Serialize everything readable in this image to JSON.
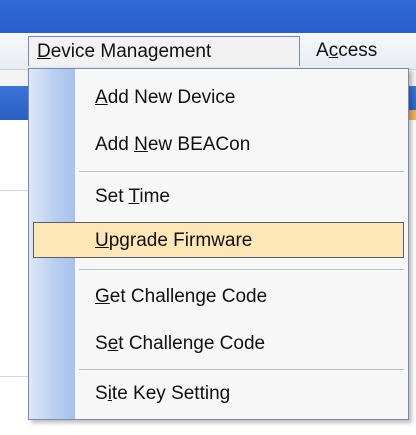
{
  "menubar": {
    "device_management": {
      "underline": "D",
      "rest": "evice Management"
    },
    "access": {
      "first": "A",
      "underline": "c",
      "rest": "cess"
    }
  },
  "menu": {
    "items": [
      {
        "pre": "",
        "underline": "A",
        "post": "dd New Device",
        "highlight": false
      },
      {
        "pre": "Add ",
        "underline": "N",
        "post": "ew BEACon",
        "highlight": false
      },
      {
        "pre": "Set ",
        "underline": "T",
        "post": "ime",
        "highlight": false
      },
      {
        "pre": "",
        "underline": "U",
        "post": "pgrade Firmware",
        "highlight": true
      },
      {
        "pre": "",
        "underline": "G",
        "post": "et Challenge Code",
        "highlight": false
      },
      {
        "pre": "S",
        "underline": "e",
        "post": "t Challenge Code",
        "highlight": false
      },
      {
        "pre": "S",
        "underline": "i",
        "post": "te Key Setting",
        "highlight": false
      }
    ]
  },
  "colors": {
    "title_bar": "#2f6ad8",
    "menu_gutter": "#b9cff2",
    "highlight_bg": "#fde7b6",
    "highlight_border": "#5a5f6c"
  }
}
